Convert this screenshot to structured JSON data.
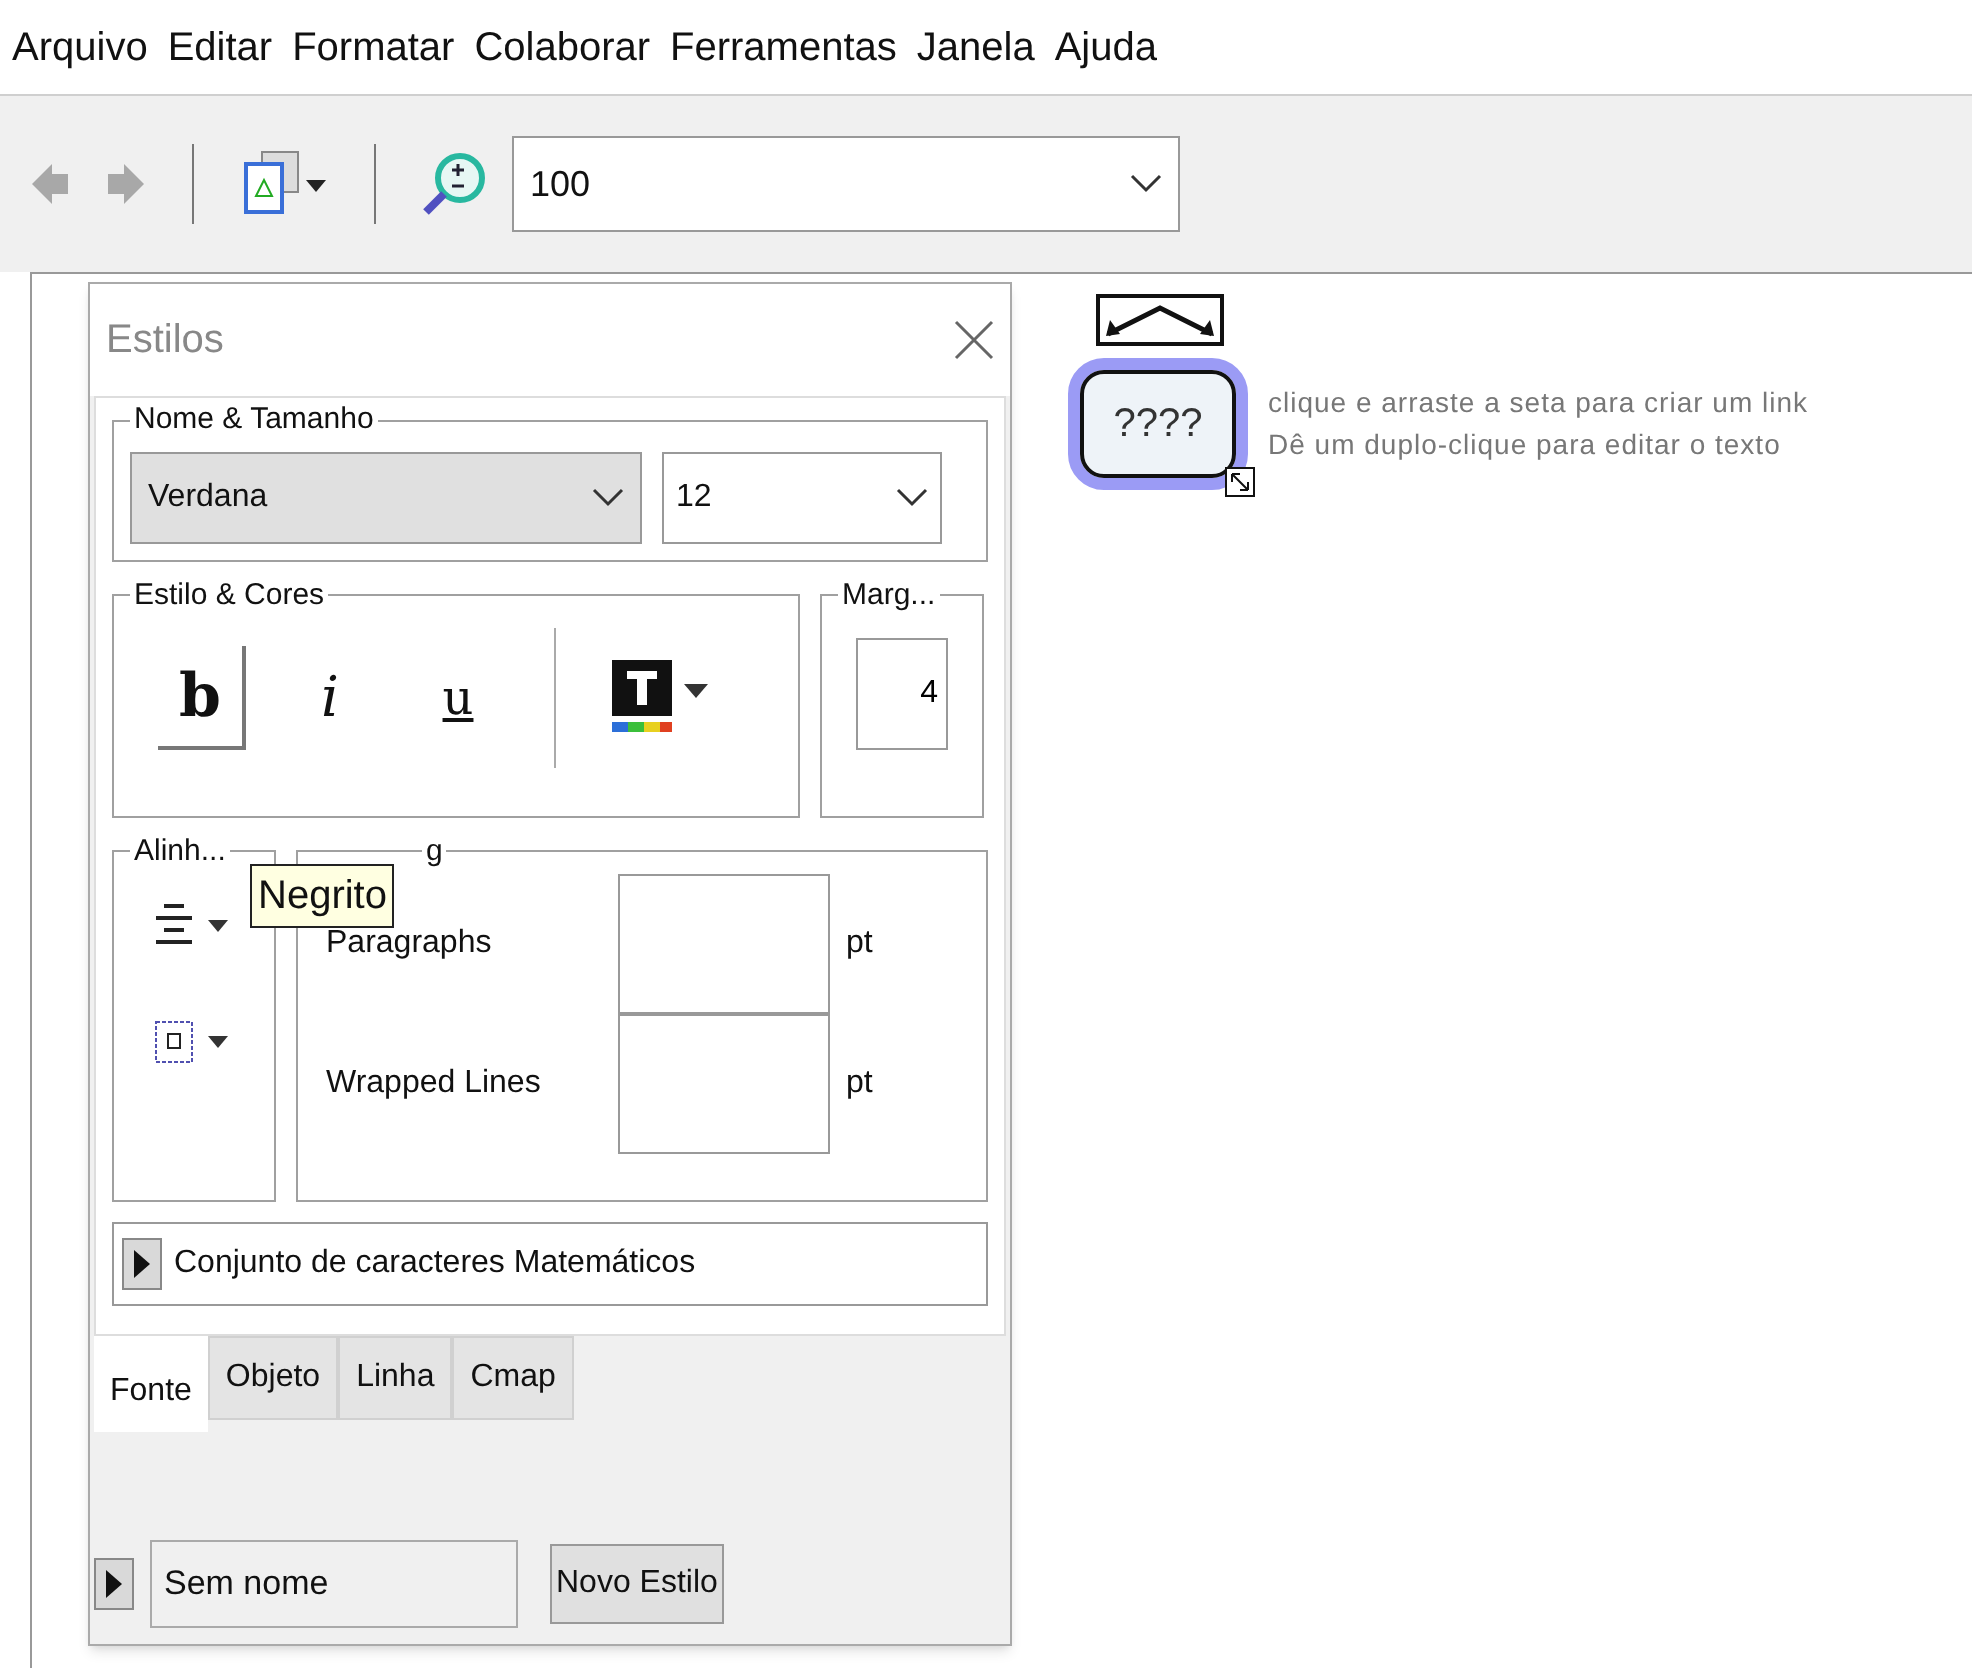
{
  "menu": [
    "Arquivo",
    "Editar",
    "Formatar",
    "Colaborar",
    "Ferramentas",
    "Janela",
    "Ajuda"
  ],
  "toolbar": {
    "zoom_value": "100"
  },
  "styles_panel": {
    "title": "Estilos",
    "name_size": {
      "label": "Nome & Tamanho",
      "font": "Verdana",
      "size": "12"
    },
    "style_colors": {
      "label": "Estilo & Cores",
      "buttons": [
        {
          "glyph": "b",
          "kind": "bold",
          "pressed": true
        },
        {
          "glyph": "i",
          "kind": "italic",
          "pressed": false
        },
        {
          "glyph": "u",
          "kind": "underline",
          "pressed": false
        }
      ]
    },
    "margin": {
      "label": "Marg...",
      "value": "4"
    },
    "alignment": {
      "label": "Alinh..."
    },
    "spacing": {
      "label": "g",
      "rows": [
        {
          "label": "Paragraphs",
          "unit": "pt"
        },
        {
          "label": "Wrapped Lines",
          "unit": "pt"
        }
      ]
    },
    "tooltip": "Negrito",
    "math_charset": {
      "label": "Conjunto de caracteres Matemáticos",
      "expanded": false
    },
    "tabs": [
      {
        "label": "Fonte",
        "selected": true
      },
      {
        "label": "Objeto",
        "selected": false
      },
      {
        "label": "Linha",
        "selected": false
      },
      {
        "label": "Cmap",
        "selected": false
      }
    ],
    "style_toggle": {
      "expanded": false
    },
    "style_name": "Sem nome",
    "new_style_button": "Novo Estilo"
  },
  "canvas": {
    "concept": "????",
    "hints": [
      "clique e arraste a seta para criar um link",
      "Dê um duplo-clique para editar o texto"
    ]
  }
}
